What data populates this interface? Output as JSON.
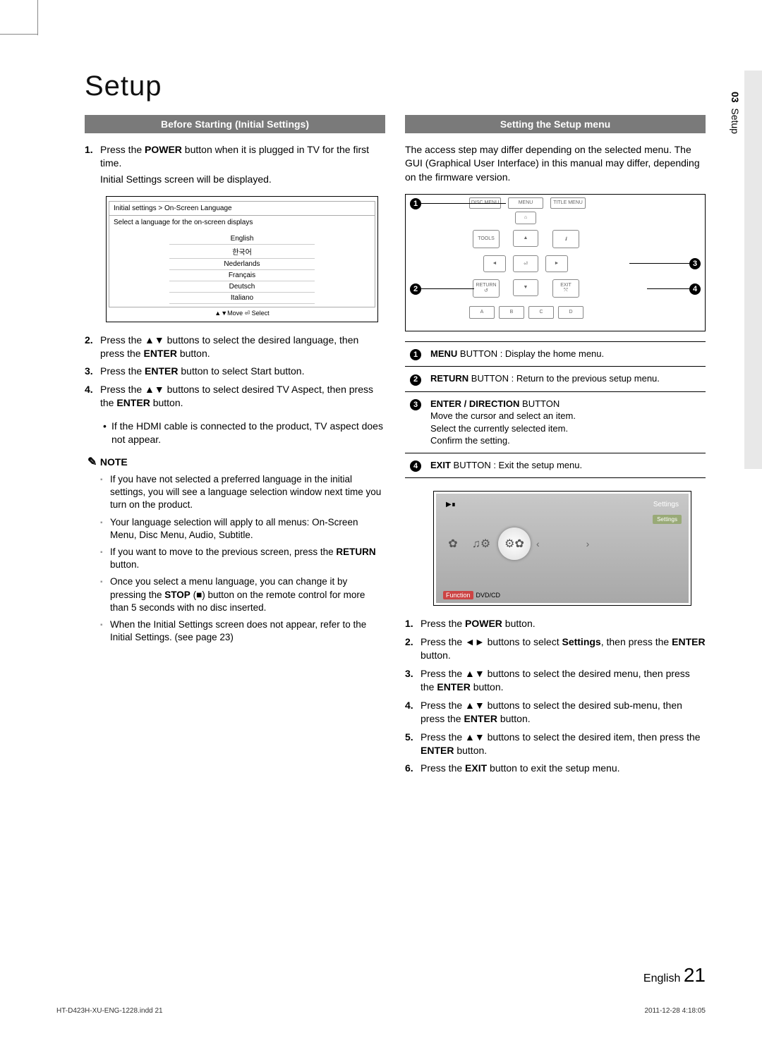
{
  "page": {
    "section_number": "03",
    "section_name": "Setup",
    "title": "Setup",
    "language_label": "English",
    "page_number": "21"
  },
  "left": {
    "heading": "Before Starting (Initial Settings)",
    "step1_a": "Press the ",
    "step1_power": "POWER",
    "step1_b": " button when it is plugged in TV for the first time.",
    "step1_sub": "Initial Settings screen will be displayed.",
    "init": {
      "crumb": "Initial settings > On-Screen Language",
      "prompt": "Select a language for the on-screen displays",
      "langs": [
        "English",
        "한국어",
        "Nederlands",
        "Français",
        "Deutsch",
        "Italiano"
      ],
      "foot": "▲▼Move   ⏎ Select"
    },
    "step2_a": "Press the ▲▼ buttons to select the desired language, then press the ",
    "step2_enter": "ENTER",
    "step2_b": " button.",
    "step3_a": "Press the ",
    "step3_enter": "ENTER",
    "step3_b": " button to select Start button.",
    "step4_a": "Press the ▲▼ buttons to select desired TV Aspect, then press the ",
    "step4_enter": "ENTER",
    "step4_b": " button.",
    "step4_bullet": "If the HDMI cable is connected to the product, TV aspect does not appear.",
    "note_label": "NOTE",
    "notes": {
      "n1": "If you have not selected a preferred language in the initial settings, you will see a language selection window next time you turn on the product.",
      "n2": "Your language selection will apply to all menus: On-Screen Menu, Disc Menu, Audio, Subtitle.",
      "n3_a": "If you want to move to the previous screen, press the ",
      "n3_return": "RETURN",
      "n3_b": " button.",
      "n4_a": "Once you select a menu language, you can change it by pressing the ",
      "n4_stop": "STOP",
      "n4_b": " (■) button on the remote control for more than 5 seconds with no disc inserted.",
      "n5": "When the Initial Settings screen does not appear, refer to the Initial Settings. (see page 23)"
    }
  },
  "right": {
    "heading": "Setting the Setup menu",
    "intro": "The access step may differ depending on the selected menu. The GUI (Graphical User Interface) in this manual may differ, depending on the firmware version.",
    "remote_labels": {
      "disc_menu": "DISC MENU",
      "menu": "MENU",
      "title_menu": "TITLE MENU",
      "tools": "TOOLS",
      "info": "INFO",
      "return": "RETURN",
      "exit": "EXIT",
      "a": "A",
      "b": "B",
      "c": "C",
      "d": "D"
    },
    "legend": {
      "r1_menu": "MENU",
      "r1_b": " BUTTON : Display the home menu.",
      "r2_return": "RETURN",
      "r2_b": " BUTTON : Return to the previous setup menu.",
      "r3_title": "ENTER / DIRECTION",
      "r3_title_b": " BUTTON",
      "r3_l1": "Move the cursor and select an item.",
      "r3_l2": "Select the currently selected item.",
      "r3_l3": "Confirm the setting.",
      "r4_exit": "EXIT",
      "r4_b": " BUTTON : Exit the setup menu."
    },
    "tv": {
      "topright": "Settings",
      "pill": "Settings",
      "bot_func": "Function",
      "bot_mode": "DVD/CD"
    },
    "steps": {
      "s1_a": "Press the ",
      "s1_power": "POWER",
      "s1_b": " button.",
      "s2_a": "Press the ◄► buttons to select ",
      "s2_settings": "Settings",
      "s2_b": ", then press the ",
      "s2_enter": "ENTER",
      "s2_c": " button.",
      "s3_a": "Press the ▲▼ buttons to select the desired menu, then press the ",
      "s3_enter": "ENTER",
      "s3_b": " button.",
      "s4_a": "Press the ▲▼ buttons to select the desired sub-menu, then press the ",
      "s4_enter": "ENTER",
      "s4_b": " button.",
      "s5_a": "Press the ▲▼ buttons to select the desired item, then press the ",
      "s5_enter": "ENTER",
      "s5_b": " button.",
      "s6_a": "Press the ",
      "s6_exit": "EXIT",
      "s6_b": " button to exit the setup menu."
    }
  },
  "printfoot": {
    "file": "HT-D423H-XU-ENG-1228.indd   21",
    "timestamp": "2011-12-28    4:18:05"
  }
}
